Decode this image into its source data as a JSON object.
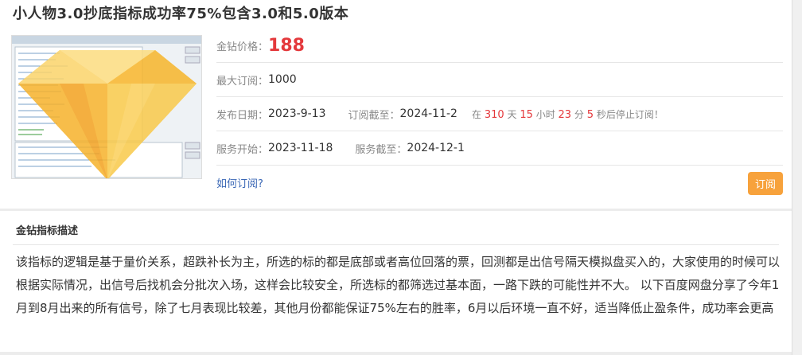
{
  "product": {
    "title": "小人物3.0抄底指标成功率75%包含3.0和5.0版本",
    "thumbnail_alt": "指标截图"
  },
  "info": {
    "price_label": "金钻价格：",
    "price_value": "188",
    "max_sub_label": "最大订阅：",
    "max_sub_value": "1000",
    "publish_label": "发布日期：",
    "publish_value": "2023-9-13",
    "sub_end_label": "订阅截至：",
    "sub_end_value": "2024-11-2",
    "countdown_prefix": "在",
    "countdown_days": "310",
    "countdown_days_unit": "天",
    "countdown_hours": "15",
    "countdown_hours_unit": "小时",
    "countdown_minutes": "23",
    "countdown_minutes_unit": "分",
    "countdown_seconds": "5",
    "countdown_suffix": "秒后停止订阅！",
    "service_start_label": "服务开始：",
    "service_start_value": "2023-11-18",
    "service_end_label": "服务截至：",
    "service_end_value": "2024-12-1",
    "how_to_link": "如何订阅?",
    "subscribe_button": "订阅"
  },
  "description": {
    "heading": "金钻指标描述",
    "text": "该指标的逻辑是基于量价关系，超跌补长为主，所选的标的都是底部或者高位回落的票，回测都是出信号隔天模拟盘买入的，大家使用的时候可以根据实际情况，出信号后找机会分批次入场，这样会比较安全，所选标的都筛选过基本面，一路下跌的可能性并不大。 以下百度网盘分享了今年1月到8月出来的所有信号，除了七月表现比较差，其他月份都能保证75%左右的胜率，6月以后环境一直不好，适当降低止盈条件，成功率会更高"
  },
  "colors": {
    "price": "#e4393c",
    "button": "#f7a23c",
    "link": "#3a67b5",
    "diamond": "#f9c23c"
  }
}
